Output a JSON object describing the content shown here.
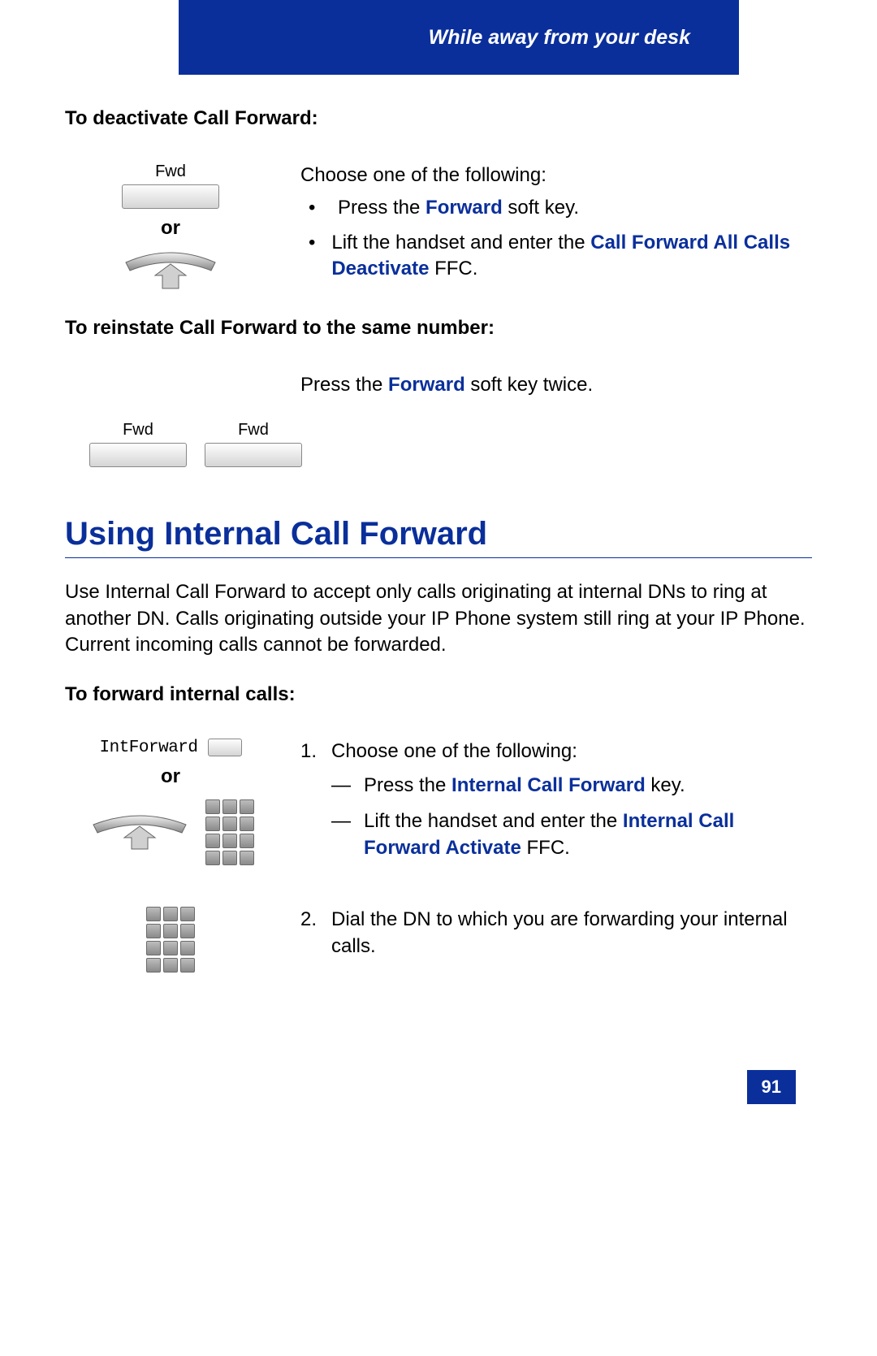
{
  "header": {
    "title": "While away from your desk"
  },
  "sec1": {
    "label": "To deactivate Call Forward:",
    "fwd_label": "Fwd",
    "or": "or",
    "intro": "Choose one of the following:",
    "bullet1_pre": "Press the ",
    "bullet1_key": "Forward",
    "bullet1_post": " soft key.",
    "bullet2_pre": "Lift the handset and enter the ",
    "bullet2_key": "Call Forward All Calls Deactivate",
    "bullet2_post": " FFC."
  },
  "sec2": {
    "label": "To reinstate Call Forward to the same number:",
    "text_pre": "Press the ",
    "text_key": "Forward",
    "text_post": " soft key twice.",
    "fwd_label1": "Fwd",
    "fwd_label2": "Fwd"
  },
  "heading": "Using Internal Call Forward",
  "para": "Use Internal Call Forward to accept only calls originating at internal DNs to ring at another DN. Calls originating outside your IP Phone system still ring at your IP Phone. Current incoming calls cannot be forwarded.",
  "sec3": {
    "label": "To forward internal calls:",
    "int_label": "IntForward",
    "or": "or",
    "step1_num": "1.",
    "step1_intro": "Choose one of the following:",
    "dash1_pre": "Press the ",
    "dash1_key": "Internal Call Forward",
    "dash1_post": " key.",
    "dash2_pre": "Lift the handset and enter the ",
    "dash2_key": "Internal Call Forward Activate",
    "dash2_post": " FFC.",
    "step2_num": "2.",
    "step2_text": "Dial the DN to which you are forwarding your internal calls."
  },
  "page_number": "91"
}
